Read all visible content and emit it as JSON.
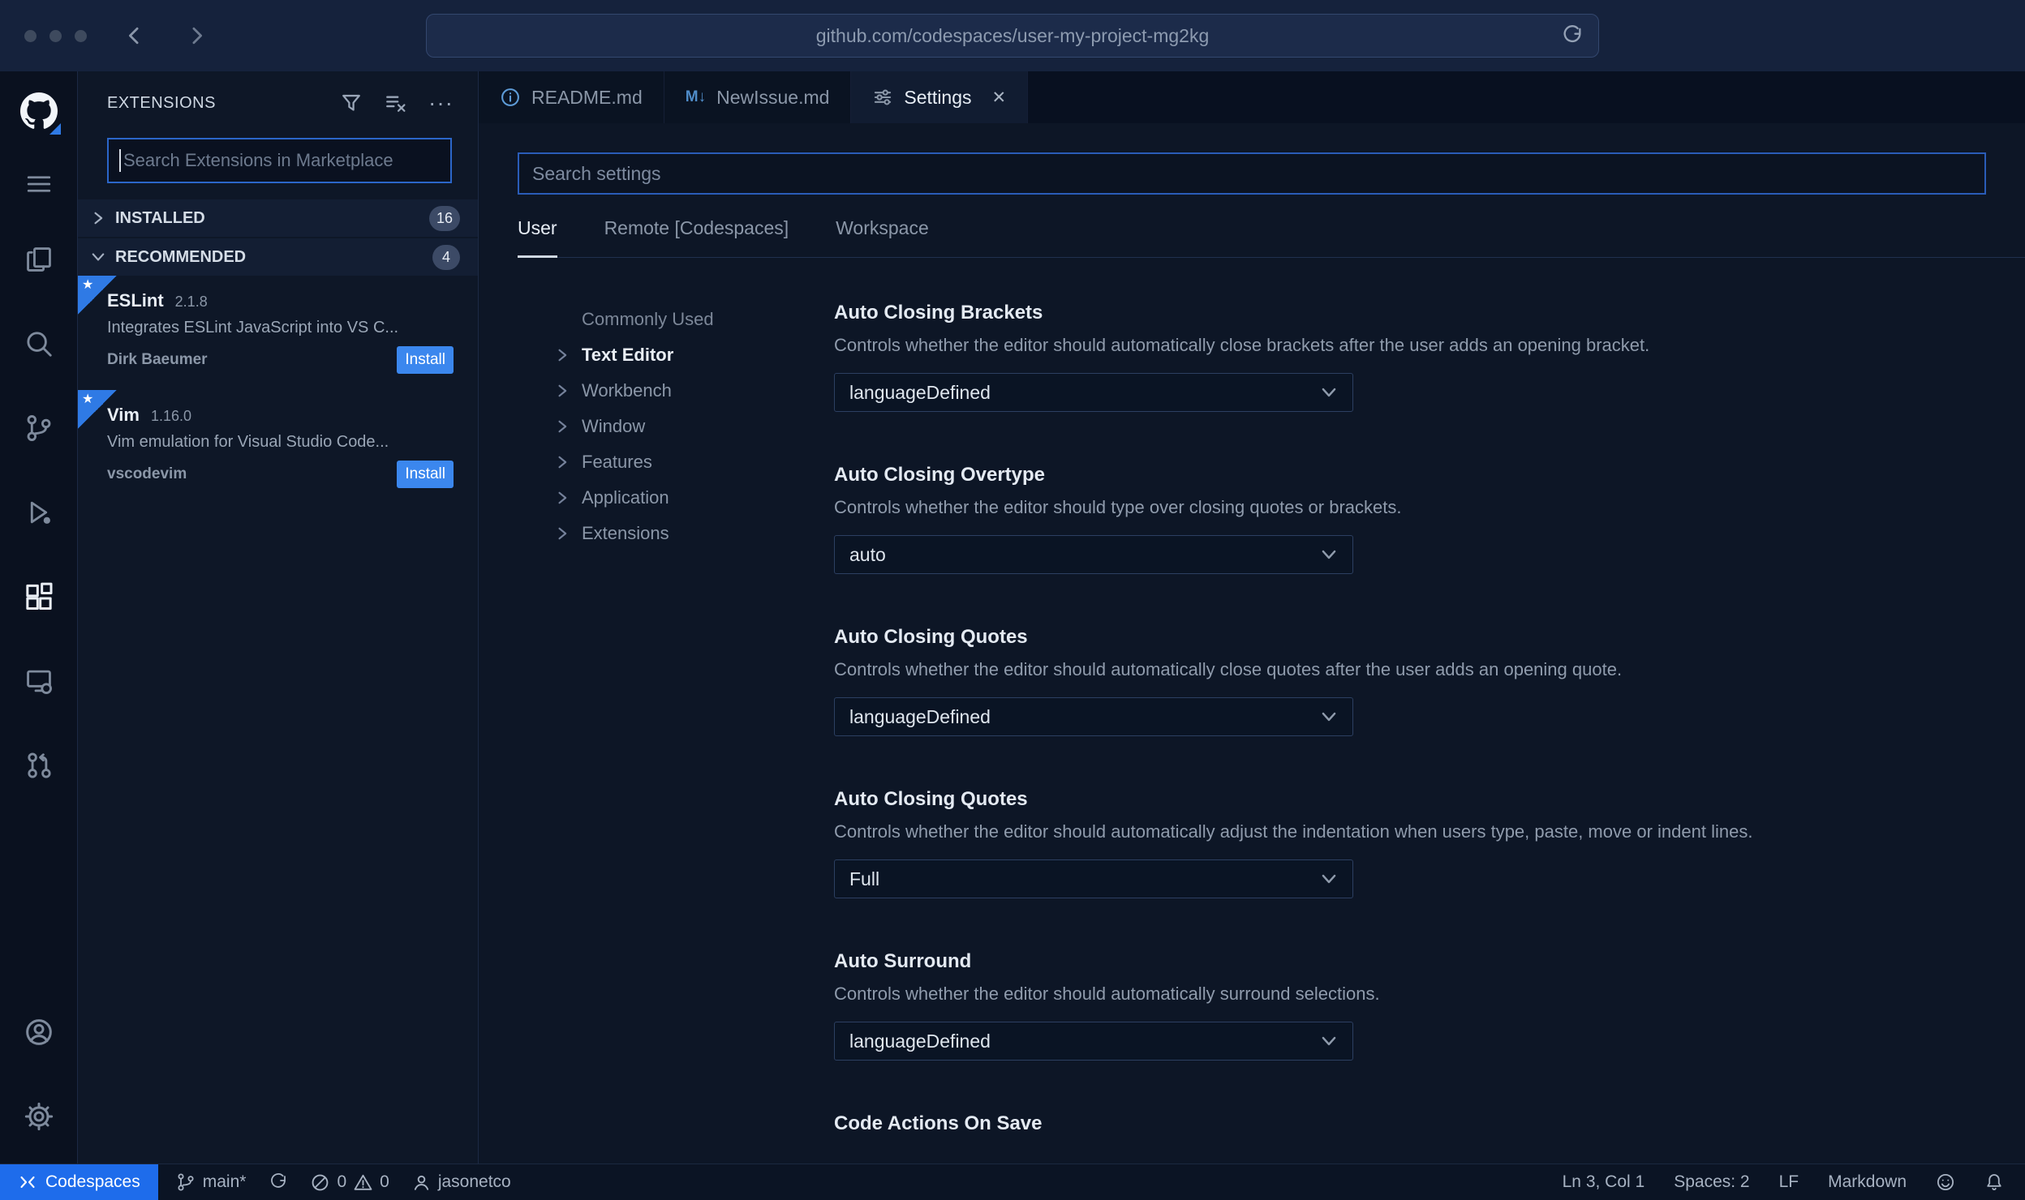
{
  "browser": {
    "url": "github.com/codespaces/user-my-project-mg2kg"
  },
  "icons": {
    "more": "···",
    "close": "✕",
    "star": "★",
    "markdown_mark": "M↓"
  },
  "sidebar": {
    "title": "EXTENSIONS",
    "search_placeholder": "Search Extensions in Marketplace",
    "sections": [
      {
        "label": "INSTALLED",
        "count": "16"
      },
      {
        "label": "RECOMMENDED",
        "count": "4"
      }
    ],
    "extensions": [
      {
        "name": "ESLint",
        "version": "2.1.8",
        "description": "Integrates ESLint JavaScript into VS C...",
        "publisher": "Dirk Baeumer",
        "action": "Install"
      },
      {
        "name": "Vim",
        "version": "1.16.0",
        "description": "Vim emulation for Visual Studio Code...",
        "publisher": "vscodevim",
        "action": "Install"
      }
    ]
  },
  "tabs": [
    {
      "label": "README.md"
    },
    {
      "label": "NewIssue.md"
    },
    {
      "label": "Settings"
    }
  ],
  "settings": {
    "search_placeholder": "Search settings",
    "scope_tabs": [
      "User",
      "Remote [Codespaces]",
      "Workspace"
    ],
    "toc": [
      "Commonly Used",
      "Text Editor",
      "Workbench",
      "Window",
      "Features",
      "Application",
      "Extensions"
    ],
    "items": [
      {
        "title": "Auto Closing Brackets",
        "description": "Controls whether the editor should automatically close brackets after the user adds an opening bracket.",
        "value": "languageDefined"
      },
      {
        "title": "Auto Closing Overtype",
        "description": "Controls whether the editor should type over closing quotes or brackets.",
        "value": "auto"
      },
      {
        "title": "Auto Closing Quotes",
        "description": "Controls whether the editor should automatically close quotes after the user adds an opening quote.",
        "value": "languageDefined"
      },
      {
        "title": "Auto Closing Quotes",
        "description": "Controls whether the editor should automatically adjust the indentation when users type, paste, move or indent lines.",
        "value": "Full"
      },
      {
        "title": "Auto Surround",
        "description": "Controls whether the editor should automatically surround selections.",
        "value": "languageDefined"
      },
      {
        "title": "Code Actions On Save"
      }
    ]
  },
  "status_bar": {
    "codespaces": "Codespaces",
    "branch": "main*",
    "errors": "0",
    "warnings": "0",
    "user": "jasonetco",
    "line_col": "Ln 3, Col 1",
    "indent": "Spaces: 2",
    "eol": "LF",
    "language": "Markdown"
  }
}
